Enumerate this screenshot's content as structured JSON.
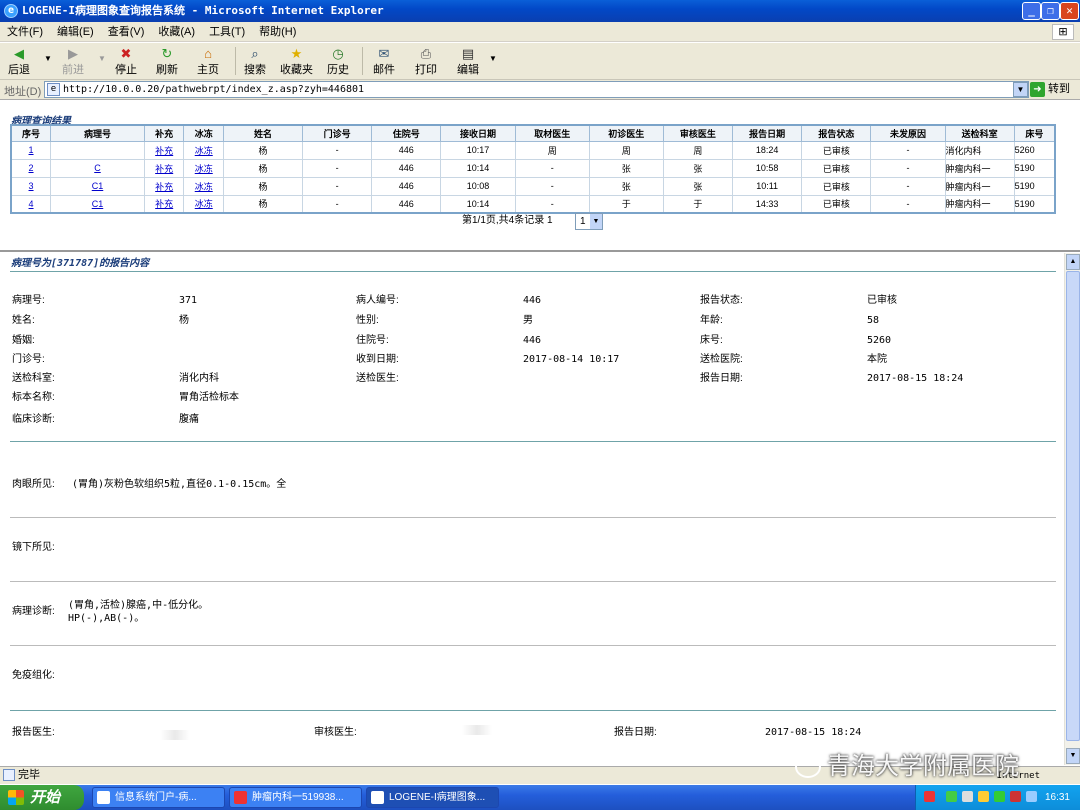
{
  "window": {
    "title": "LOGENE-I病理图象查询报告系统 - Microsoft Internet Explorer"
  },
  "menu": [
    "文件(F)",
    "编辑(E)",
    "查看(V)",
    "收藏(A)",
    "工具(T)",
    "帮助(H)"
  ],
  "toolbar": {
    "back": "后退",
    "forward": "前进",
    "stop": "停止",
    "refresh": "刷新",
    "home": "主页",
    "search": "搜索",
    "favorites": "收藏夹",
    "history": "历史",
    "mail": "邮件",
    "print": "打印",
    "edit": "编辑"
  },
  "address": {
    "label": "地址(D)",
    "url": "http://10.0.0.20/pathwebrpt/index_z.asp?zyh=446801",
    "go": "转到"
  },
  "query": {
    "title": "病理查询结果",
    "headers": [
      "序号",
      "病理号",
      "补充",
      "冰冻",
      "姓名",
      "门诊号",
      "住院号",
      "接收日期",
      "取材医生",
      "初诊医生",
      "审核医生",
      "报告日期",
      "报告状态",
      "未发原因",
      "送检科室",
      "床号"
    ],
    "rows": [
      [
        "1",
        "",
        "补充",
        "冰冻",
        "杨",
        "-",
        "446",
        "10:17",
        "周",
        "周",
        "周",
        "18:24",
        "已审核",
        "-",
        "消化内科",
        "5260"
      ],
      [
        "2",
        "C",
        "补充",
        "冰冻",
        "杨",
        "-",
        "446",
        "10:14",
        "-",
        "张",
        "张",
        "10:58",
        "已审核",
        "-",
        "肿瘤内科一",
        "5190"
      ],
      [
        "3",
        "C1",
        "补充",
        "冰冻",
        "杨",
        "-",
        "446",
        "10:08",
        "-",
        "张",
        "张",
        "10:11",
        "已审核",
        "-",
        "肿瘤内科一",
        "5190"
      ],
      [
        "4",
        "C1",
        "补充",
        "冰冻",
        "杨",
        "-",
        "446",
        "10:14",
        "-",
        "于",
        "于",
        "14:33",
        "已审核",
        "-",
        "肿瘤内科一",
        "5190"
      ]
    ],
    "pager": "第1/1页,共4条记录  1",
    "page_select": "1"
  },
  "report": {
    "title": "病理号为[371787]的报告内容",
    "fields": [
      {
        "label": "病理号:",
        "value": "371"
      },
      {
        "label": "病人编号:",
        "value": "446"
      },
      {
        "label": "报告状态:",
        "value": "已审核"
      },
      {
        "label": "姓名:",
        "value": "杨"
      },
      {
        "label": "性别:",
        "value": "男"
      },
      {
        "label": "年龄:",
        "value": "58"
      },
      {
        "label": "婚姻:",
        "value": ""
      },
      {
        "label": "住院号:",
        "value": "446"
      },
      {
        "label": "床号:",
        "value": "5260"
      },
      {
        "label": "门诊号:",
        "value": ""
      },
      {
        "label": "收到日期:",
        "value": "2017-08-14 10:17"
      },
      {
        "label": "送检医院:",
        "value": "本院"
      },
      {
        "label": "送检科室:",
        "value": "消化内科"
      },
      {
        "label": "送检医生:",
        "value": ""
      },
      {
        "label": "报告日期:",
        "value": "2017-08-15 18:24"
      },
      {
        "label": "标本名称:",
        "value": "胃角活检标本"
      },
      {
        "label": "临床诊断:",
        "value": "腹痛"
      }
    ],
    "gross_label": "肉眼所见:",
    "gross": "(胃角)灰粉色软组织5粒,直径0.1-0.15cm。全",
    "micro_label": "镜下所见:",
    "diag_label": "病理诊断:",
    "diag_line1": "(胃角,活检)腺癌,中-低分化。",
    "diag_line2": "HP(-),AB(-)。",
    "immuno_label": "免疫组化:",
    "sig_reporter_label": "报告医生:",
    "sig_reviewer_label": "审核医生:",
    "sig_date_label": "报告日期:",
    "sig_date": "2017-08-15 18:24"
  },
  "status": {
    "text": "完毕",
    "zone": "Internet"
  },
  "taskbar": {
    "start": "开始",
    "tasks": [
      "信息系统门户-病...",
      "肿瘤内科一519938...",
      "LOGENE-I病理图象..."
    ],
    "time": "16:31"
  },
  "watermark": "青海大学附属医院"
}
